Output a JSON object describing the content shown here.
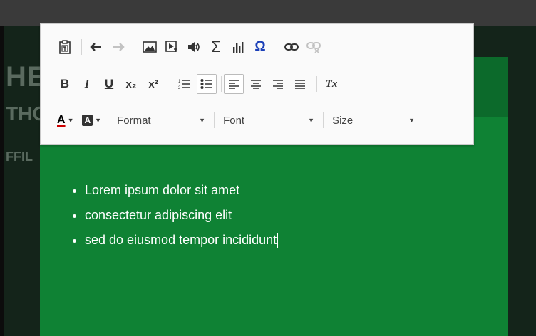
{
  "background": {
    "ghost_line1": "HE",
    "ghost_line2": "THO",
    "ghost_line3": "FFIL"
  },
  "toolbar": {
    "row1": [
      {
        "name": "paste-text-icon",
        "glyph": "⎘"
      },
      {
        "name": "undo-icon",
        "glyph": "↶"
      },
      {
        "name": "redo-icon",
        "glyph": "↷"
      },
      {
        "name": "image-icon",
        "glyph": "▣"
      },
      {
        "name": "flash-icon",
        "glyph": "▶"
      },
      {
        "name": "audio-icon",
        "glyph": "🔊"
      },
      {
        "name": "sigma-icon",
        "glyph": "Σ"
      },
      {
        "name": "chart-icon",
        "glyph": "ılıl"
      },
      {
        "name": "special-char-icon",
        "glyph": "Ω"
      },
      {
        "name": "link-icon",
        "glyph": "🔗"
      },
      {
        "name": "unlink-icon",
        "glyph": "⛓"
      }
    ],
    "bold": "B",
    "italic": "I",
    "underline": "U",
    "subscript": "x₂",
    "superscript": "x²",
    "remove_format": "Tx",
    "font_color": "A",
    "bg_color": "A",
    "format_label": "Format",
    "font_label": "Font",
    "size_label": "Size"
  },
  "content": {
    "items": [
      "Lorem ipsum dolor sit amet",
      "consectetur adipiscing elit",
      "sed do eiusmod tempor incididunt"
    ]
  },
  "colors": {
    "editor_bg": "#0f8234",
    "editor_header": "#0c6a2b",
    "toolbar_bg": "#fafafa"
  }
}
